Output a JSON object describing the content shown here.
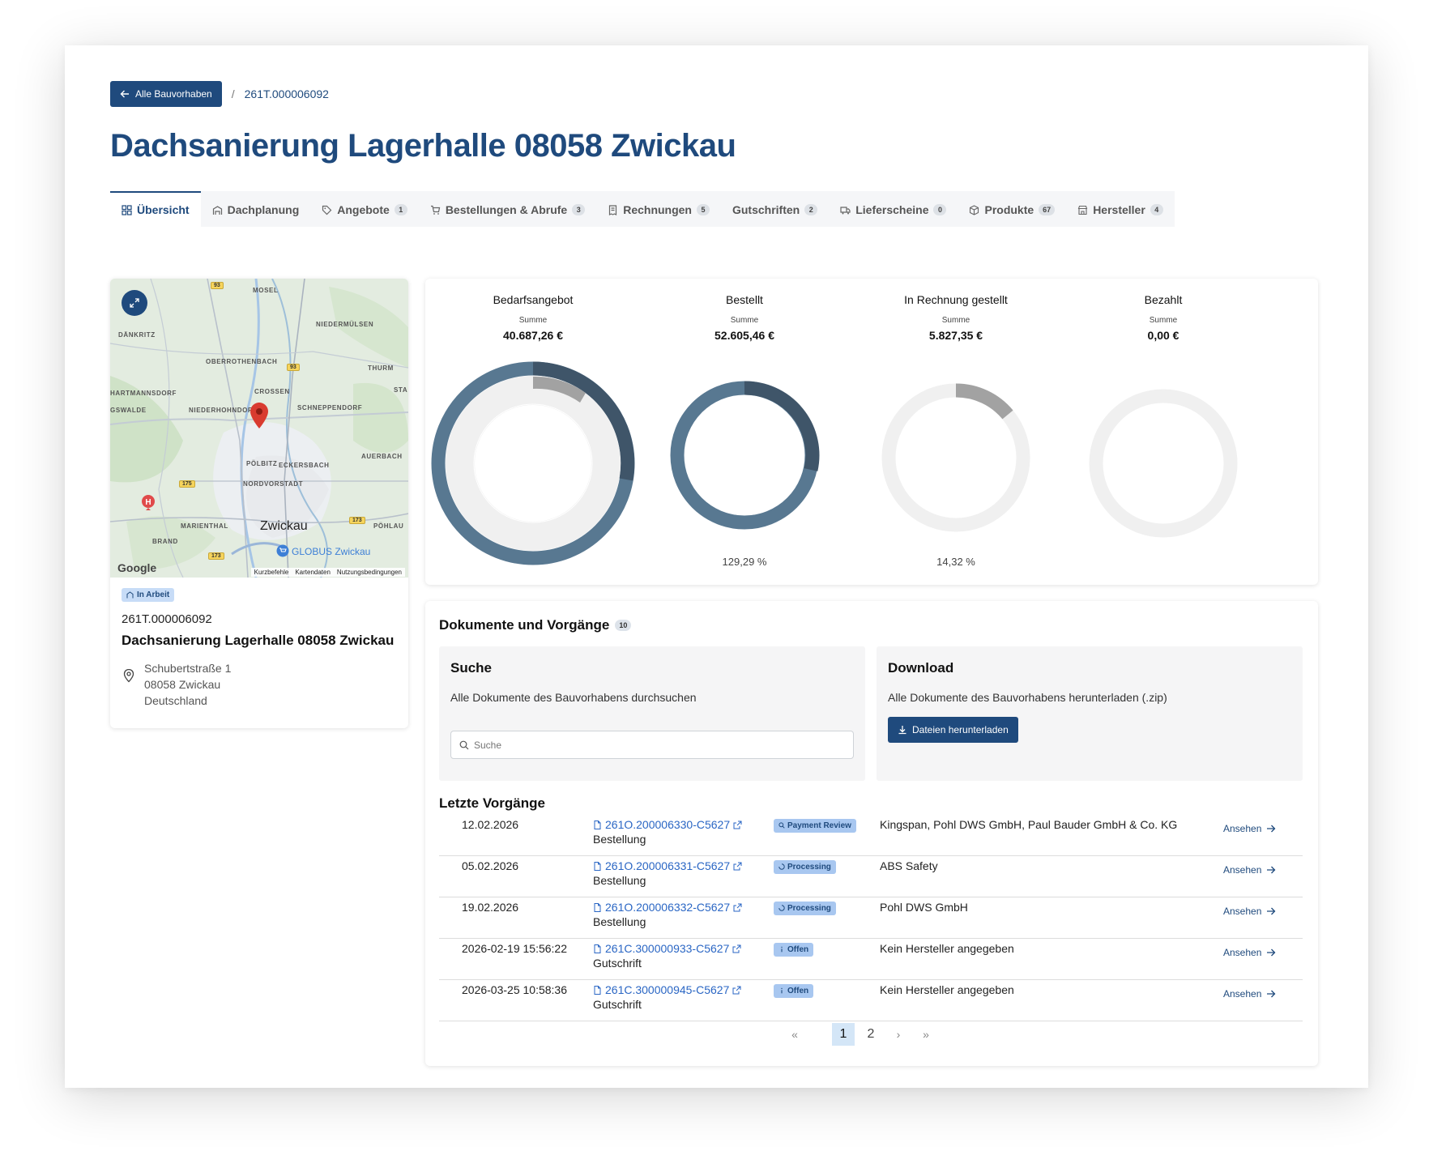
{
  "breadcrumb": {
    "back_label": "Alle Bauvorhaben",
    "separator": "/",
    "current": "261T.000006092"
  },
  "page_title": "Dachsanierung Lagerhalle 08058 Zwickau",
  "tabs": [
    {
      "label": "Übersicht",
      "icon": "grid-icon",
      "badge": null,
      "active": true
    },
    {
      "label": "Dachplanung",
      "icon": "building-icon",
      "badge": null
    },
    {
      "label": "Angebote",
      "icon": "tag-icon",
      "badge": "1"
    },
    {
      "label": "Bestellungen & Abrufe",
      "icon": "cart-icon",
      "badge": "3"
    },
    {
      "label": "Rechnungen",
      "icon": "receipt-icon",
      "badge": "5"
    },
    {
      "label": "Gutschriften",
      "icon": null,
      "badge": "2"
    },
    {
      "label": "Lieferscheine",
      "icon": "truck-icon",
      "badge": "0"
    },
    {
      "label": "Produkte",
      "icon": "box-icon",
      "badge": "67"
    },
    {
      "label": "Hersteller",
      "icon": "store-icon",
      "badge": "4"
    }
  ],
  "map": {
    "labels": [
      "MOSEL",
      "NIEDERMÜLSEN",
      "DÄNKRITZ",
      "OBERROTHENBACH",
      "THURM",
      "HARTMANNSDORF",
      "CROSSEN",
      "STA",
      "GSWALDE",
      "NIEDERHOHNDORF",
      "SCHNEPPENDORF",
      "AUERBACH",
      "PÖLBITZ",
      "ECKERSBACH",
      "NORDVORSTADT",
      "MARIENTHAL",
      "PÖHLAU",
      "BRAND"
    ],
    "city": "Zwickau",
    "poi": "GLOBUS Zwickau",
    "roads": [
      "93",
      "93",
      "175",
      "173",
      "173"
    ],
    "attribution": "Google",
    "footer": [
      "Kurzbefehle",
      "Kartendaten",
      "Nutzungsbedingungen"
    ]
  },
  "project": {
    "status": "In Arbeit",
    "code": "261T.000006092",
    "name": "Dachsanierung Lagerhalle 08058 Zwickau",
    "address": [
      "Schubertstraße 1",
      "08058 Zwickau",
      "Deutschland"
    ]
  },
  "colors": {
    "primary": "#1f4a7d",
    "ring_dark": "#3f5569",
    "ring_mid": "#587891",
    "ring_gray": "#a2a2a2",
    "ring_track": "#f0f0f0"
  },
  "summary": {
    "sum_label": "Summe",
    "columns": [
      {
        "title": "Bedarfsangebot",
        "value": "40.687,26 €",
        "percent": ""
      },
      {
        "title": "Bestellt",
        "value": "52.605,46 €",
        "percent": "129,29 %"
      },
      {
        "title": "In Rechnung gestellt",
        "value": "5.827,35 €",
        "percent": "14,32 %"
      },
      {
        "title": "Bezahlt",
        "value": "0,00 €",
        "percent": ""
      }
    ]
  },
  "documents": {
    "title": "Dokumente und Vorgänge",
    "count": "10",
    "search": {
      "title": "Suche",
      "description": "Alle Dokumente des Bauvorhabens durchsuchen",
      "placeholder": "Suche"
    },
    "download": {
      "title": "Download",
      "description": "Alle Dokumente des Bauvorhabens herunterladen (.zip)",
      "button": "Dateien herunterladen"
    },
    "recent_title": "Letzte Vorgänge",
    "rows": [
      {
        "date": "12.02.2026",
        "doc": "261O.200006330-C5627",
        "type": "Bestellung",
        "status": "Payment Review",
        "status_icon": "search-icon",
        "vendor": "Kingspan, Pohl DWS GmbH, Paul Bauder GmbH & Co. KG",
        "action": "Ansehen"
      },
      {
        "date": "05.02.2026",
        "doc": "261O.200006331-C5627",
        "type": "Bestellung",
        "status": "Processing",
        "status_icon": "loader-icon",
        "vendor": "ABS Safety",
        "action": "Ansehen"
      },
      {
        "date": "19.02.2026",
        "doc": "261O.200006332-C5627",
        "type": "Bestellung",
        "status": "Processing",
        "status_icon": "loader-icon",
        "vendor": "Pohl DWS GmbH",
        "action": "Ansehen"
      },
      {
        "date": "2026-02-19 15:56:22",
        "doc": "261C.300000933-C5627",
        "type": "Gutschrift",
        "status": "Offen",
        "status_icon": "info-icon",
        "vendor": "Kein Hersteller angegeben",
        "action": "Ansehen"
      },
      {
        "date": "2026-03-25 10:58:36",
        "doc": "261C.300000945-C5627",
        "type": "Gutschrift",
        "status": "Offen",
        "status_icon": "info-icon",
        "vendor": "Kein Hersteller angegeben",
        "action": "Ansehen"
      }
    ],
    "pagination": {
      "first": "«",
      "pages": [
        "1",
        "2"
      ],
      "current": "1",
      "next": "›",
      "last": "»"
    }
  }
}
